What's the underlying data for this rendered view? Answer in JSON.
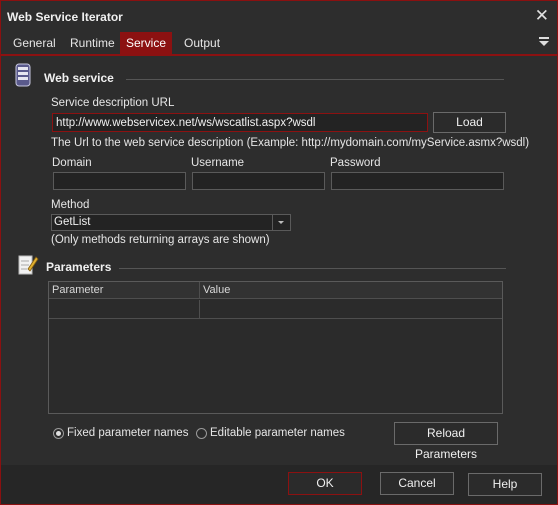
{
  "window": {
    "title": "Web Service Iterator",
    "close_glyph": "✕"
  },
  "tabs": [
    {
      "label": "General"
    },
    {
      "label": "Runtime"
    },
    {
      "label": "Service",
      "active": true
    },
    {
      "label": "Output"
    }
  ],
  "web_service": {
    "section_title": "Web service",
    "url_label": "Service description URL",
    "url_value": "http://www.webservicex.net/ws/wscatlist.aspx?wsdl",
    "load_label": "Load",
    "url_hint": "The Url to the web service description (Example: http://mydomain.com/myService.asmx?wsdl)",
    "domain_label": "Domain",
    "domain_value": "",
    "username_label": "Username",
    "username_value": "",
    "password_label": "Password",
    "password_value": "",
    "method_label": "Method",
    "method_value": "GetList",
    "method_hint": "(Only methods returning arrays are shown)"
  },
  "parameters": {
    "section_title": "Parameters",
    "columns": [
      "Parameter",
      "Value"
    ],
    "fixed_label": "Fixed parameter names",
    "editable_label": "Editable parameter names",
    "selected": "fixed",
    "reload_label": "Reload Parameters"
  },
  "footer": {
    "ok_label": "OK",
    "cancel_label": "Cancel",
    "help_label": "Help"
  },
  "colors": {
    "accent": "#8c1111",
    "background": "#2d2d2d"
  }
}
